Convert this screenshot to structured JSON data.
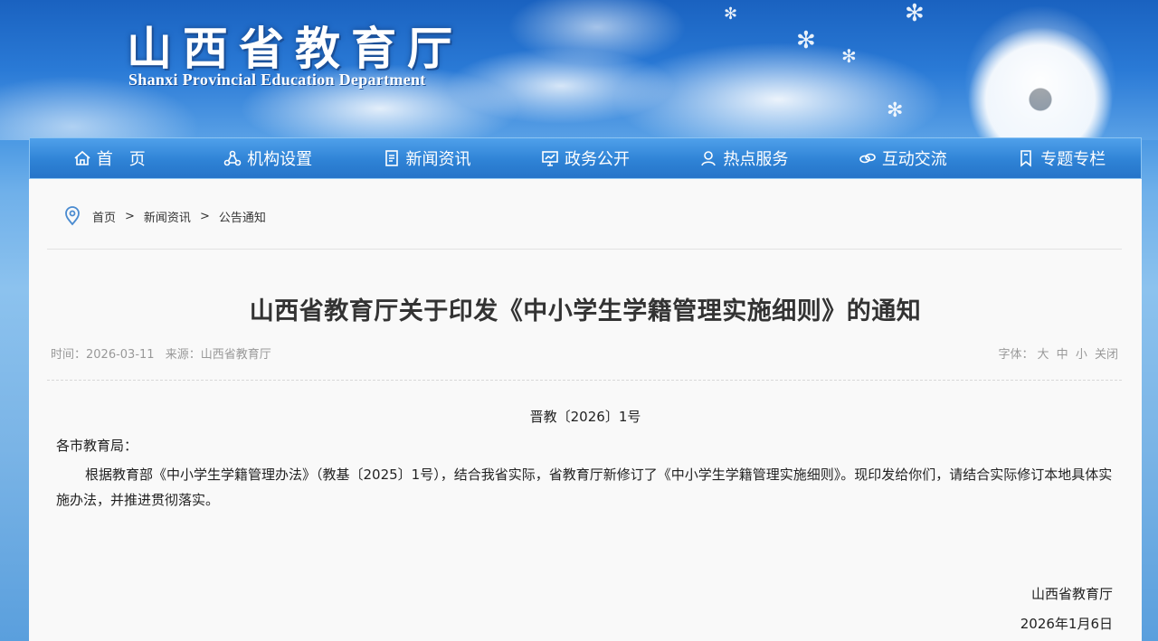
{
  "header": {
    "logo_cn": "山西省教育厅",
    "logo_en": "Shanxi Provincial Education Department"
  },
  "nav": {
    "items": [
      {
        "label": "首　页",
        "icon": "home-icon"
      },
      {
        "label": "机构设置",
        "icon": "org-structure-icon"
      },
      {
        "label": "新闻资讯",
        "icon": "document-icon"
      },
      {
        "label": "政务公开",
        "icon": "chart-board-icon"
      },
      {
        "label": "热点服务",
        "icon": "user-service-icon"
      },
      {
        "label": "互动交流",
        "icon": "link-icon"
      },
      {
        "label": "专题专栏",
        "icon": "bookmark-icon"
      }
    ]
  },
  "breadcrumb": {
    "icon": "location-pin-icon",
    "items": [
      "首页",
      "新闻资讯",
      "公告通知"
    ],
    "separator": ">"
  },
  "article": {
    "title": "山西省教育厅关于印发《中小学生学籍管理实施细则》的通知",
    "meta_time": "时间：2026-03-11",
    "meta_source": "来源：山西省教育厅",
    "font_label": "字体：",
    "font_large": "大",
    "font_medium": "中",
    "font_small": "小",
    "font_close": "关闭",
    "doc_number": "晋教〔2026〕1号",
    "addressee": "各市教育局：",
    "body": "根据教育部《中小学生学籍管理办法》（教基〔2025〕1号），结合我省实际，省教育厅新修订了《中小学生学籍管理实施细则》。现印发给你们，请结合实际修订本地具体实施办法，并推进贯彻落实。",
    "signature": "山西省教育厅",
    "date": "2026年1月6日"
  },
  "colors": {
    "nav_bg": "#2f83d6",
    "panel_bg": "#f9f9f9",
    "title_text": "#333333",
    "meta_text": "#999999"
  }
}
